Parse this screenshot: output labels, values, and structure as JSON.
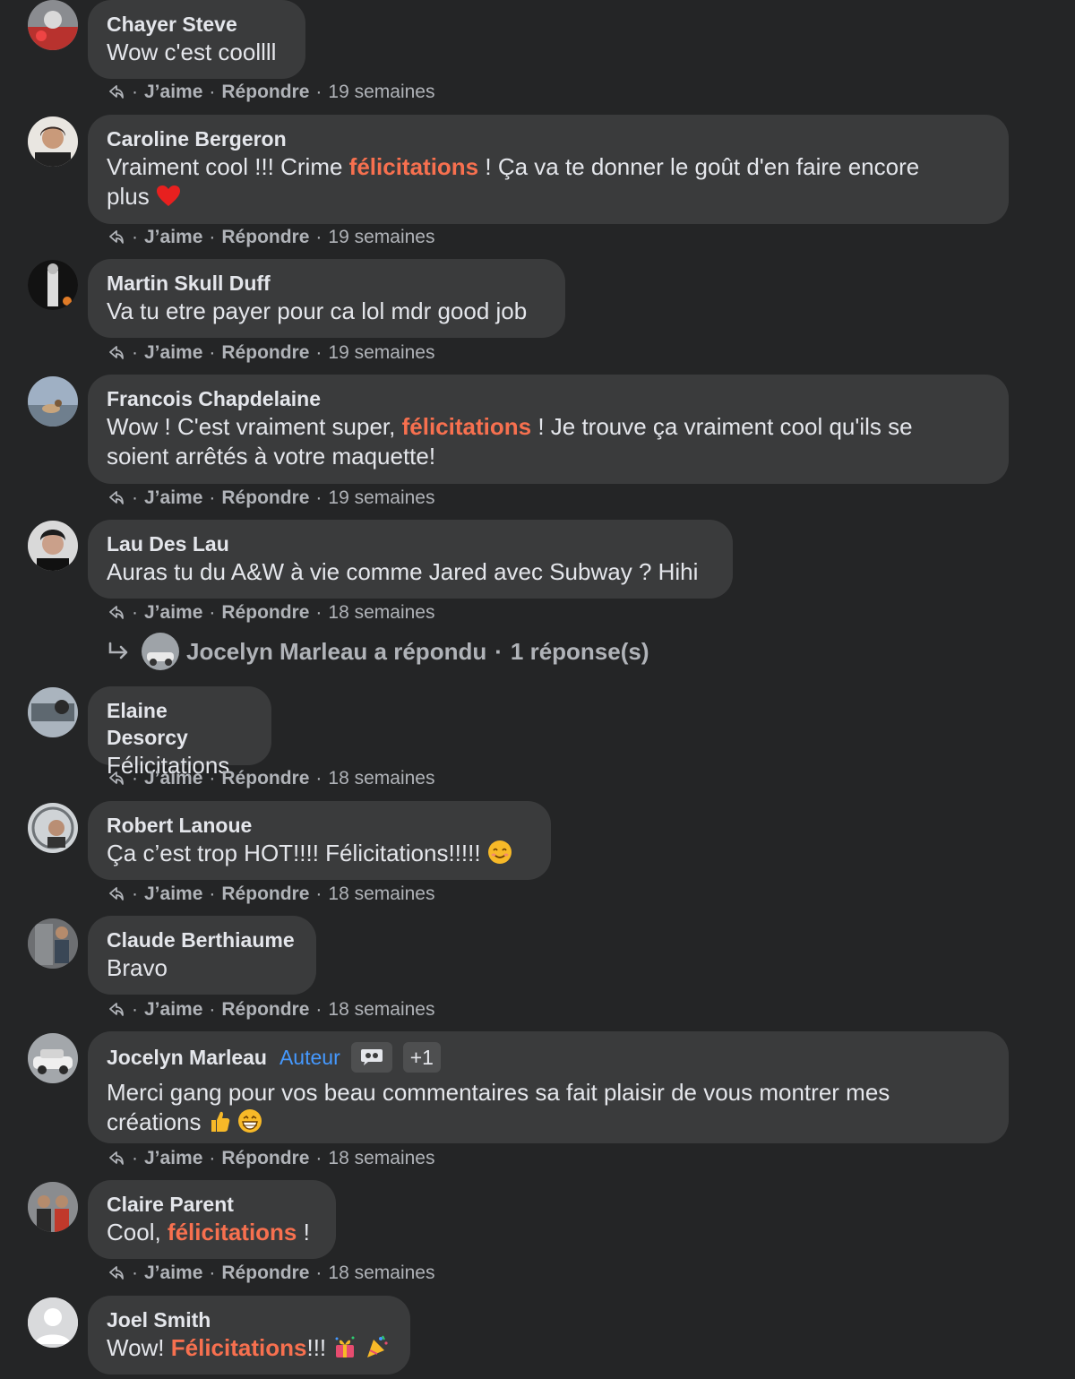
{
  "colors": {
    "background": "#242526",
    "bubble": "#3a3b3c",
    "highlight": "#f7704f",
    "author_badge": "#4599ff",
    "meta_text": "#b0b3b8"
  },
  "actions": {
    "like": "J’aime",
    "reply": "Répondre",
    "separator": "·"
  },
  "comments": [
    {
      "name": "Chayer Steve",
      "parts": [
        "Wow c'est coollll"
      ],
      "time": "19 semaines",
      "avatar_icon": "photo-avatar"
    },
    {
      "name": "Caroline Bergeron",
      "parts": [
        "Vraiment cool !!! Crime ",
        "félicitations",
        " ! Ça va te donner le goût d'en faire encore",
        "plus"
      ],
      "emoji": "red-heart-icon",
      "time": "19 semaines"
    },
    {
      "name": "Martin Skull Duff",
      "parts": [
        "Va tu etre payer pour ca lol mdr good job"
      ],
      "time": "19 semaines"
    },
    {
      "name": "Francois Chapdelaine",
      "parts": [
        "Wow ! C'est vraiment super, ",
        "félicitations",
        " ! Je trouve ça vraiment cool qu'ils se",
        "soient arrêtés à votre maquette!"
      ],
      "time": "19 semaines"
    },
    {
      "name": "Lau Des Lau",
      "parts": [
        "Auras tu du A&W à vie comme Jared avec Subway ? Hihi"
      ],
      "time": "18 semaines"
    },
    {
      "name": "Elaine Desorcy",
      "parts": [
        "Félicitations"
      ],
      "time": "18 semaines"
    },
    {
      "name": "Robert Lanoue",
      "parts": [
        "Ça c’est trop HOT!!!! Félicitations!!!!!"
      ],
      "emoji": "smiling-face-icon",
      "time": "18 semaines"
    },
    {
      "name": "Claude Berthiaume",
      "parts": [
        "Bravo"
      ],
      "time": "18 semaines"
    },
    {
      "name": "Jocelyn Marleau",
      "author_badge": "Auteur",
      "badge_count": "+1",
      "parts": [
        "Merci gang pour vos beau commentaires sa fait plaisir de vous montrer mes",
        "créations"
      ],
      "emoji": "thumbs-up-grin-icon",
      "time": "18 semaines"
    },
    {
      "name": "Claire Parent",
      "parts": [
        "Cool, ",
        "félicitations",
        " !"
      ],
      "time": "18 semaines"
    },
    {
      "name": "Joel Smith",
      "parts": [
        "Wow! ",
        "Félicitations",
        "!!!"
      ],
      "emoji": "party-icon"
    }
  ],
  "reply_summary": {
    "name": "Jocelyn Marleau",
    "text": "a répondu",
    "count": "1 réponse(s)"
  }
}
